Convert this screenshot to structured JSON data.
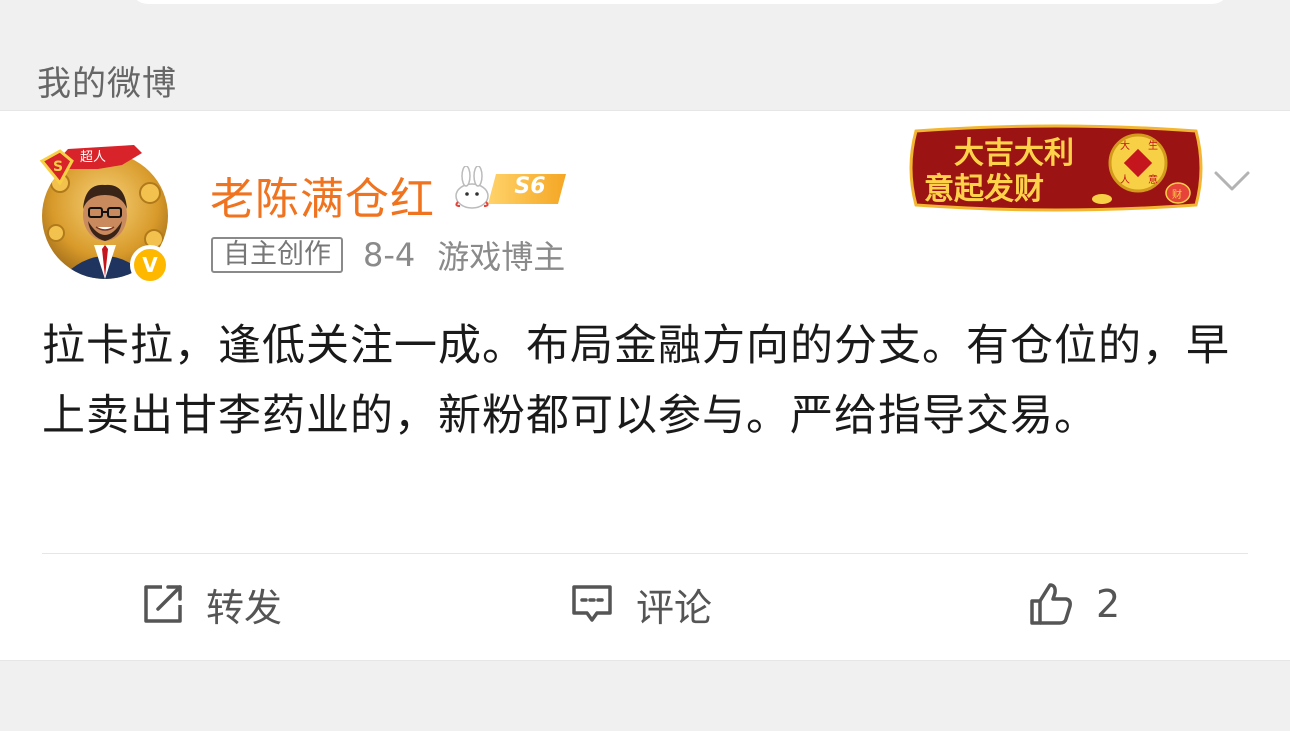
{
  "section": {
    "title": "我的微博"
  },
  "post": {
    "author": {
      "name": "老陈满仓红",
      "level": "S6",
      "avatar_badge": "超人",
      "verified_mark": "V"
    },
    "meta": {
      "tag": "自主创作",
      "date": "8-4",
      "role": "游戏博主"
    },
    "decoration": {
      "text": "大吉大利 意起发财",
      "coin": "大 生 人 意",
      "bag": "财"
    },
    "content": "拉卡拉，逢低关注一成。布局金融方向的分支。有仓位的，早上卖出甘李药业的，新粉都可以参与。严给指导交易。",
    "actions": {
      "repost_label": "转发",
      "comment_label": "评论",
      "like_count": "2"
    }
  },
  "colors": {
    "username": "#f0731f",
    "background": "#f0f0f0",
    "verified": "#ffb800",
    "banner": "#9c1313"
  },
  "icons": [
    "verified-icon",
    "level-badge-icon",
    "chevron-down-icon",
    "repost-icon",
    "comment-icon",
    "like-icon"
  ]
}
